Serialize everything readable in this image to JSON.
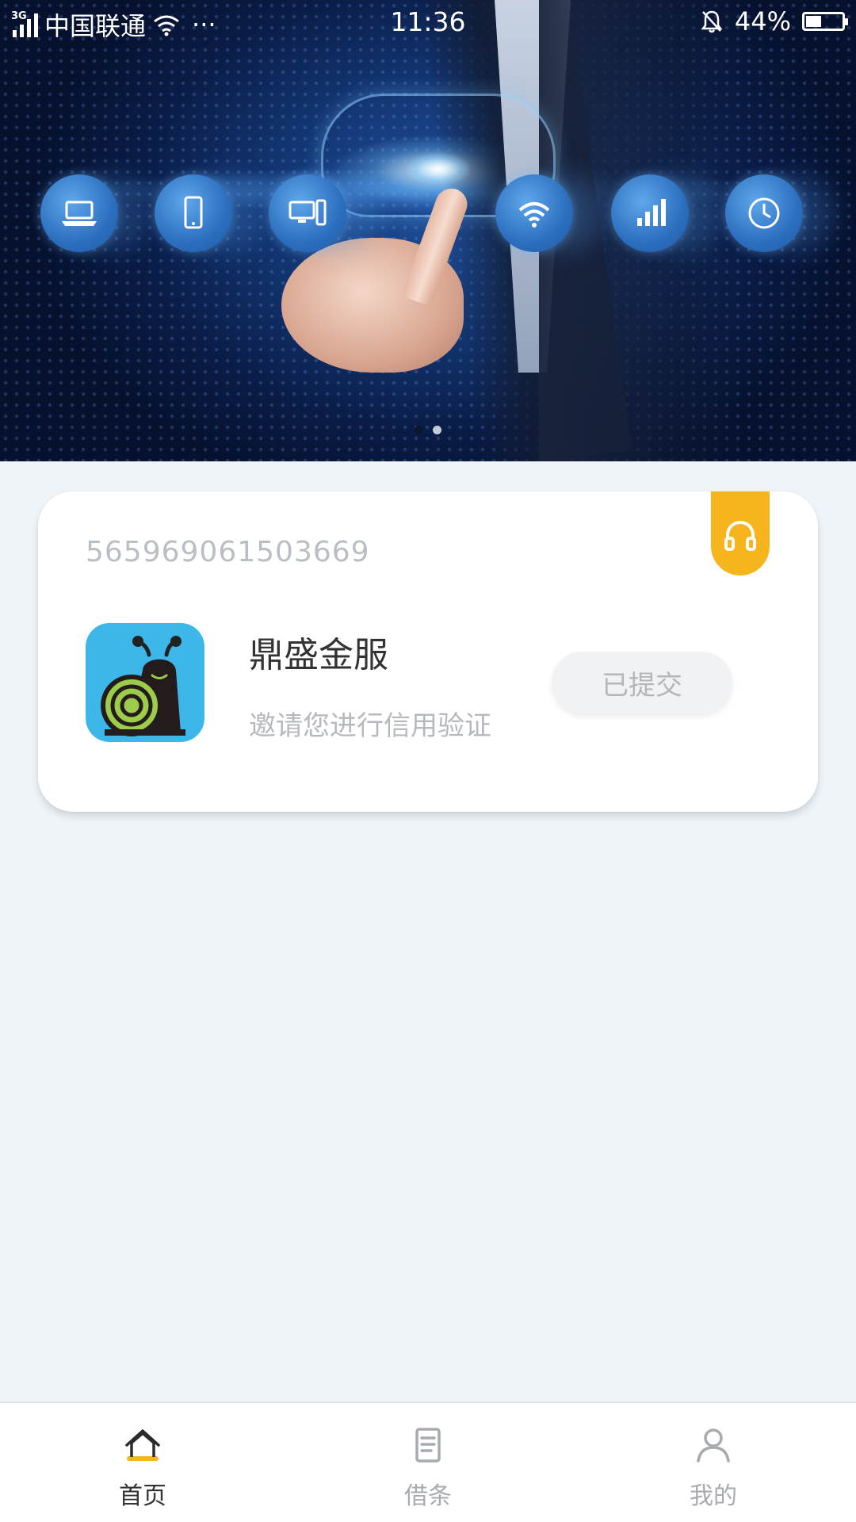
{
  "status_bar": {
    "network_type": "3G",
    "carrier": "中国联通",
    "more": "···",
    "time": "11:36",
    "battery_percent": "44%",
    "battery_level": 0.44
  },
  "banner": {
    "page_count": 2,
    "active_page": 0,
    "device_icons": [
      "laptop-icon",
      "phone-icon",
      "desktop-icon",
      "wifi-icon",
      "signal-bars-icon",
      "clock-icon"
    ]
  },
  "card": {
    "id_number": "565969061503669",
    "support_icon": "headset-icon",
    "app_logo_icon": "snail-icon",
    "app_name": "鼎盛金服",
    "description": "邀请您进行信用验证",
    "status_label": "已提交"
  },
  "bottom_nav": {
    "items": [
      {
        "label": "首页",
        "icon": "home-icon",
        "active": true
      },
      {
        "label": "借条",
        "icon": "document-icon",
        "active": false
      },
      {
        "label": "我的",
        "icon": "user-icon",
        "active": false
      }
    ]
  },
  "colors": {
    "accent": "#f6b51d",
    "page_background": "#eef4f8",
    "logo_background": "#3db6ea",
    "text_primary": "#333333",
    "text_muted": "#b5b9be"
  }
}
